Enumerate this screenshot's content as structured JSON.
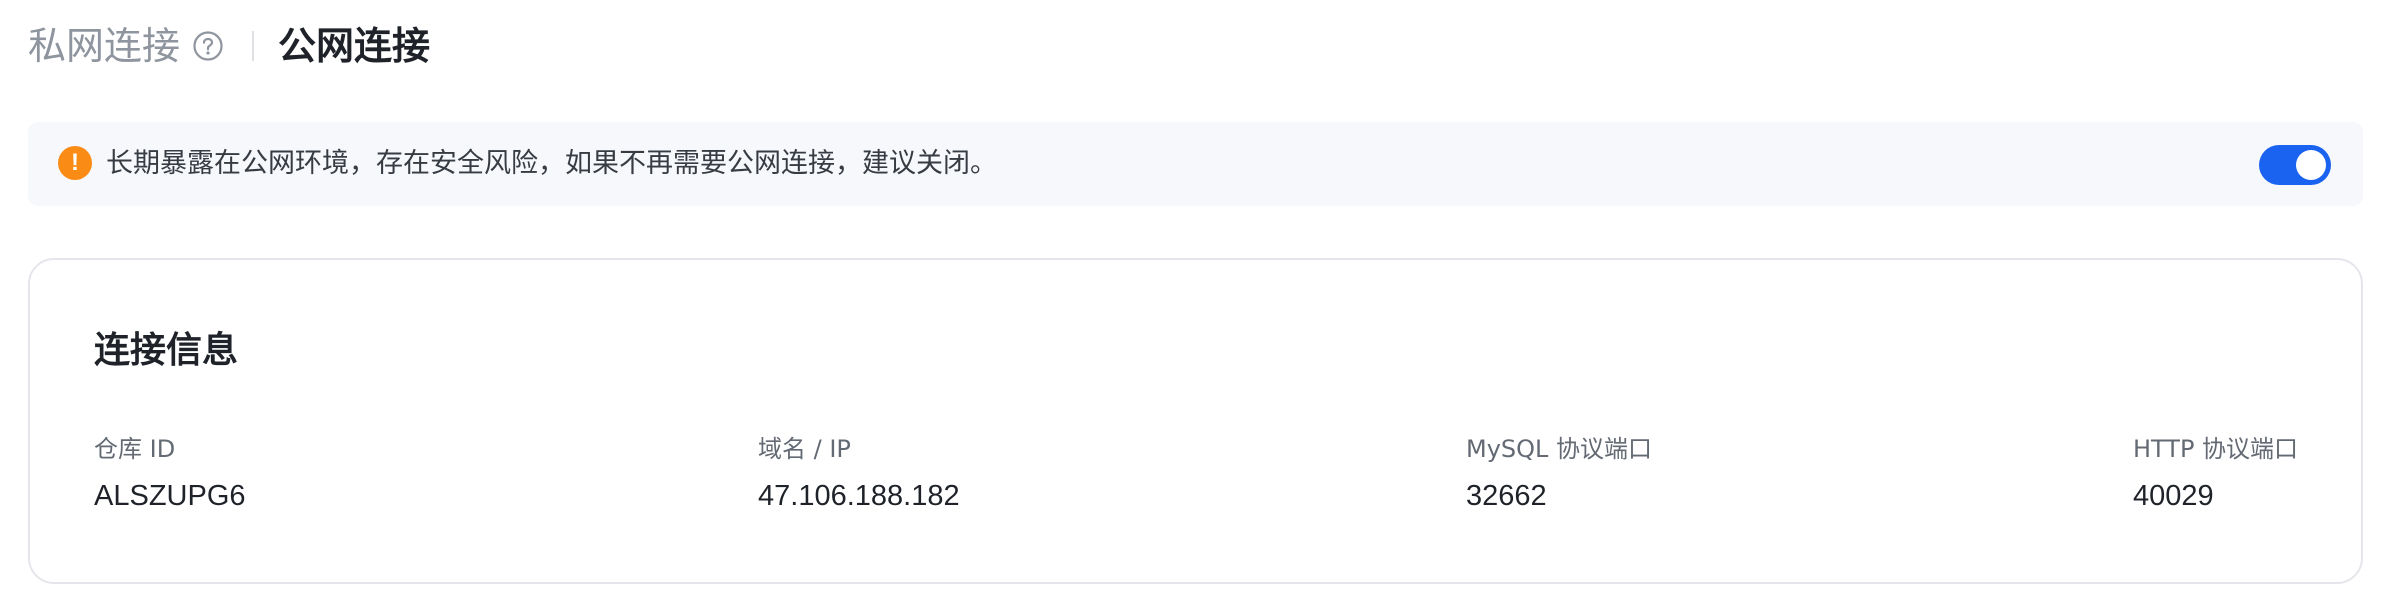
{
  "tabs": {
    "private": {
      "label": "私网连接"
    },
    "public": {
      "label": "公网连接"
    }
  },
  "alert": {
    "icon_glyph": "!",
    "message": "长期暴露在公网环境，存在安全风险，如果不再需要公网连接，建议关闭。",
    "toggle_on": true,
    "colors": {
      "warning": "#fa8c16",
      "toggle": "#1a62f0",
      "background": "#f6f8fc"
    }
  },
  "connection": {
    "title": "连接信息",
    "fields": [
      {
        "label": "仓库 ID",
        "value": "ALSZUPG6"
      },
      {
        "label": "域名 / IP",
        "value": "47.106.188.182"
      },
      {
        "label": "MySQL 协议端口",
        "value": "32662"
      },
      {
        "label": "HTTP 协议端口",
        "value": "40029"
      }
    ]
  },
  "icons": {
    "help": "question-circle-icon",
    "warning": "exclamation-circle-icon"
  }
}
